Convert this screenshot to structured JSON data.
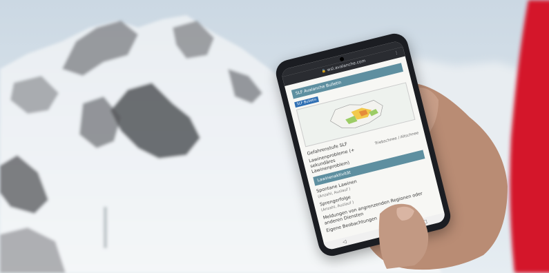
{
  "url": "wsl.avalanche.com",
  "sections": {
    "map_header": "SLF Avalanche Bulletin",
    "map_badge": "SLF Bulletin",
    "danger_label": "Gefahrenstufe SLF",
    "problem_label": "Lawinenprobleme (+ sekundäres Lawinenproblem)",
    "problem_value": "Triebschnee / Altschnee",
    "observations_header": "Lawinenaktivität",
    "spontaneous_label": "Spontane Lawinen",
    "spontaneous_sub": "(Anzahl, Auslauf )",
    "triggered_label": "Sprengerfolge",
    "triggered_sub": "(Anzahl, Auslauf )",
    "reports_label": "Meldungen von angrenzenden Regionen oder anderen Diensten",
    "own_obs_label": "Eigene Beobachtungen"
  },
  "nav": {
    "back": "◁",
    "home": "○",
    "recent": "□"
  },
  "colors": {
    "sky": "#d9e3ec",
    "snow": "#eef1f4",
    "rock": "#4a4c50",
    "jacket": "#d4192a",
    "skin": "#b98c74"
  }
}
